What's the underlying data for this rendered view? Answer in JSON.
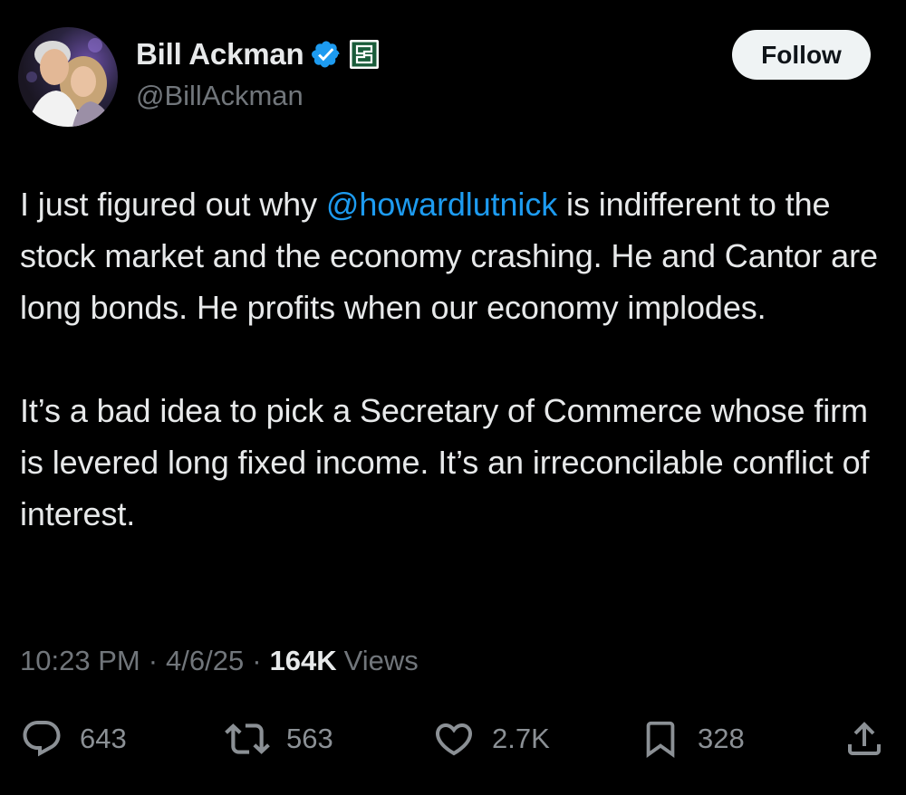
{
  "author": {
    "display_name": "Bill Ackman",
    "handle": "@BillAckman",
    "verified": true,
    "avatar_icon": "profile-photo"
  },
  "follow": {
    "label": "Follow"
  },
  "tweet": {
    "paragraph1_before": "I just figured out why ",
    "mention": "@howardlutnick",
    "paragraph1_after": " is indifferent to the stock market and the economy crashing. He and Cantor are long bonds. He profits when our economy implodes.",
    "paragraph2": "It’s a bad idea to pick a Secretary of Commerce whose firm is levered long fixed income. It’s an irreconcilable conflict of interest."
  },
  "meta": {
    "time": "10:23 PM",
    "separator": "·",
    "date": "4/6/25",
    "views_count": "164K",
    "views_label": "Views"
  },
  "actions": {
    "replies": "643",
    "reposts": "563",
    "likes": "2.7K",
    "bookmarks": "328"
  },
  "colors": {
    "background": "#000000",
    "text": "#e7e9ea",
    "secondary": "#71767b",
    "link": "#1d9bf0",
    "verified": "#1d9bf0",
    "affiliate_badge": "#1a5c3a"
  }
}
